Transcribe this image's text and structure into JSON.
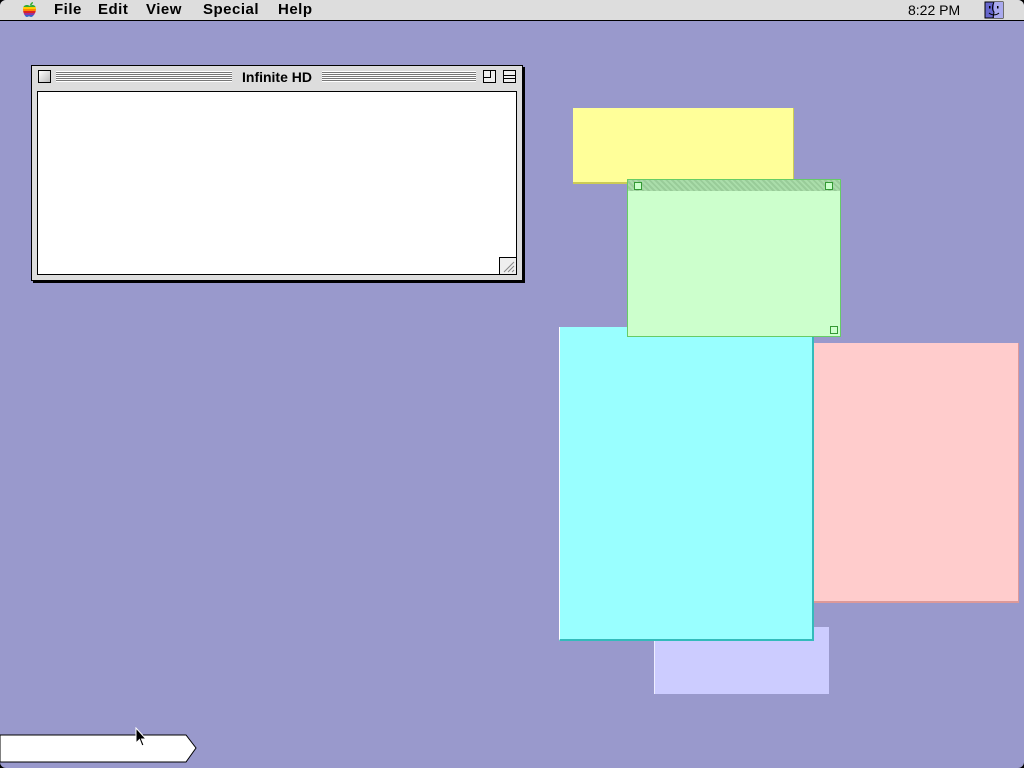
{
  "menubar": {
    "items": [
      {
        "label": "File"
      },
      {
        "label": "Edit"
      },
      {
        "label": "View"
      },
      {
        "label": "Special"
      },
      {
        "label": "Help"
      }
    ],
    "clock": "8:22 PM"
  },
  "finder_window": {
    "title": "Infinite HD"
  },
  "stickies": [
    {
      "color": "#ffff99"
    },
    {
      "color": "#ccffcc"
    },
    {
      "color": "#99ffff"
    },
    {
      "color": "#ffcccc"
    },
    {
      "color": "#ccccff"
    }
  ],
  "icons": [
    "apple-icon",
    "finder-icon",
    "close-icon",
    "zoom-icon",
    "collapse-icon",
    "grow-icon",
    "cursor-icon"
  ],
  "colors": {
    "desktop": "#9999cc",
    "menubar": "#dddddd"
  }
}
